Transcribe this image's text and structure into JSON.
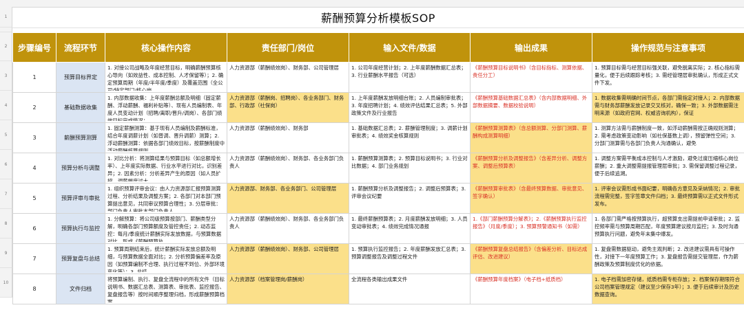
{
  "sheet_title": "薪酬预算分析模板SOP",
  "row_numbers": [
    "1",
    "2",
    "3",
    "4",
    "5",
    "6",
    "7",
    "8",
    "9",
    "10"
  ],
  "headers": [
    "步骤编号",
    "流程环节",
    "核心操作内容",
    "责任部门/岗位",
    "输入文件/数据",
    "输出成果",
    "操作规范与注意事项"
  ],
  "colors": {
    "header_bg": "#c0930c",
    "header_text": "#ffffff",
    "process_bg": "#dbe5f3",
    "highlight_yellow": "#fbe08a",
    "output_red": "#d93025"
  },
  "rows": [
    {
      "step": "1",
      "process": "预算目标界定",
      "operation": "1. 对接公司战略及年度经营目标，明确薪酬预算核心导向（如效益性、成本控制、人才保留等）；2. 确定预算周期（年度/半年度/季度）及覆盖范围（全公司/特定部门/核心岗",
      "dept": "人力资源部（薪酬绩效岗）、财务部、公司管理层",
      "input": "1. 公司年度经营计划；2. 上年度薪酬数据汇总表；3. 行业薪酬水平报告（可选）",
      "output": "《薪酬预算目标说明书》（含目标指标、测算依据、责任分工）",
      "notes": "1. 预算目标需与经营目标强关联，避免脱离实际；2. 核心指标需量化，便于后续跟踪考核；3. 需经管理层审批确认，形成正式文件下发。"
    },
    {
      "step": "2",
      "process": "基础数据收集",
      "operation": "1. 内部数据收集：上年度薪酬总额及明细（固定薪酬、浮动薪酬、福利补贴等）、现有人员编制表、年度人员变动计划（招聘/离职/晋升/调岗）、各部门绩效目标完成情况；",
      "dept": "人力资源部（薪酬岗、招聘岗）、各业务部门、财务部、行政部（社保岗）",
      "input": "1. 上年度薪酬发放明细台账；2. 人员编制审批表；3. 年度招聘计划；4. 绩效评估结果汇总表；5. 外部政策文件及行业报告",
      "output": "《薪酬预算基础数据汇总表》（含内部数据明细、外部数据摘要、数据校验说明）",
      "notes": "1. 数据收集需明确时间节点，各部门需指定对接人；2. 内部数据需与财务部薪酬发放记录交叉核对，确保一致；3. 外部数据需注明来源（如政府官网、权威咨询机构），保证",
      "dept_hl": true,
      "notes_hl": true
    },
    {
      "step": "3",
      "process": "薪酬预算测算",
      "operation": "1. 固定薪酬测算：基于现有人员编制及薪酬标准，结合年度调薪计划（如普调、晋升调薪）测算；2. 浮动薪酬测算：依据各部门绩效目标，按薪酬制度中浮动薪酬核算规则",
      "dept": "人力资源部（薪酬绩效岗）、财务部",
      "input": "1. 基础数据汇总表；2. 薪酬管理制度；3. 调薪计划审批表；4. 绩效奖金核算规则",
      "output": "《薪酬预算测算表》（含总额测算、分部门测算、薪酬构成测算明细）",
      "notes": "1. 测算方法需与薪酬制度一致，如浮动薪酬需按正确规则测算；2. 需考虑政策变动影响（如社保基数上调），预留弹性空间；3. 分部门测算需与各部门负责人沟通确认，避免",
      "output_hl": true
    },
    {
      "step": "4",
      "process": "预算分析与调整",
      "operation": "1. 对比分析：将测算结果与预算目标（如总额增长率）、上年度实际数据、行业水平进行对比，识别差异；2. 因素分析：分析差异产生的原因（如人员扩招、调薪幅度过大、",
      "dept": "人力资源部（薪酬绩效岗）、财务部、各业务部门负责人",
      "input": "1. 薪酬预算测算表；2. 预算目标说明书；3. 行业对比数据；4. 部门业务规划",
      "output": "《薪酬预算分析及调整报告》（含差异分析、调整方案、调整后预算表）",
      "notes": "1. 调整方案需平衡成本控制与人才激励，避免过度压缩核心岗位薪酬；2. 重大调整需提报管理层审批；3. 需保留调整过程记录，便于后续追溯。",
      "output_hl": true
    },
    {
      "step": "5",
      "process": "预算评审与审批",
      "operation": "1. 组织预算评审会议：由人力资源部汇报预算测算过程、分析结果及调整方案；2. 各部门对本部门预算提出意见，共同审议预算合理性；3. 分层审批：部门负责人审批本部门负责人",
      "dept": "人力资源部、财务部、各业务部门、公司管理层",
      "input": "1. 薪酬预算分析及调整报告；2. 调整后预算表；3. 评审会议纪要",
      "output": "《薪酬预算审批表》（含最终预算数据、审批意见、签字确认）",
      "notes": "1. 评审会议需形成书面纪要，明确各方意见及采纳情况；2. 审批流程需完整，签字签章文件归档；3. 最终预算需以正式文件形式发布。",
      "dept_hl": true,
      "output_hl": true,
      "notes_hl": true
    },
    {
      "step": "6",
      "process": "预算执行与监控",
      "operation": "1. 分解预算：将公司级预算按部门、薪酬类型分解，明确各部门预算额度及管控责任；2. 动态监控：每月/季度统计薪酬实际发放数据，与预算数据对比，形成《薪酬预算执",
      "dept": "人力资源部（薪酬绩效岗）、财务部、各业务部门负责人",
      "input": "1. 最终薪酬预算表；2. 月度薪酬发放明细；3. 人员变动审批表；4. 绩效完成情况通报",
      "output": "1.《部门薪酬预算分解表》；2.《薪酬预算执行监控报告》（月度/季度）；3. 预算预警通知书（如需）",
      "notes": "1. 各部门需严格按预算执行，超预算支出需提前申请审批；2. 监控频率需与预算周期匹配，年度预算建议按月监控；3. 及时沟通预算执行问题，避免年末集中爆发。"
    },
    {
      "step": "7",
      "process": "预算复盘与总结",
      "operation": "1. 预算周期结束后，统计薪酬实际发放总额及明细，与预算数据全面对比；2. 分析预算偏差率及原因（如预算编制不合理、执行过程不到位、外部环境变化等）；3. 总结",
      "dept": "人力资源部（薪酬绩效岗）、财务部、公司管理层",
      "input": "1. 预算执行监控报告；2. 年度薪酬发放汇总表；3. 预算调整报告及调整过程文件",
      "output": "《薪酬预算复盘总结报告》（含偏差分析、目标达成评估、改进建议）",
      "notes": "1. 复盘需数据驱动，避免主观判断；2. 改进建议需具有可操作性，对接下一年度预算工作；3. 复盘报告需提交管理层，作为薪酬政策及预算制度优化的依据。",
      "dept_hl": true,
      "output_hl": true
    },
    {
      "step": "8",
      "process": "文件归档",
      "operation": "将预算编制、执行、复盘全流程中的所有文件（目标说明书、数据汇总表、测算表、审批表、监控报告、复盘报告等）按时间顺序整理归档，形成薪酬预算档案。",
      "dept": "人力资源部（档案管理岗/薪酬岗）",
      "input": "全流程各类输出成果文件",
      "output": "《薪酬预算年度档案》（电子档+纸质档）",
      "notes": "1. 电子档需加密存储，纸质档需专柜存放；2. 档案保存期限符合公司档案管理规定（建议至少保存3年）；3. 便于后续审计及历史数据查询。",
      "dept_hl": true,
      "notes_hl": true
    }
  ]
}
